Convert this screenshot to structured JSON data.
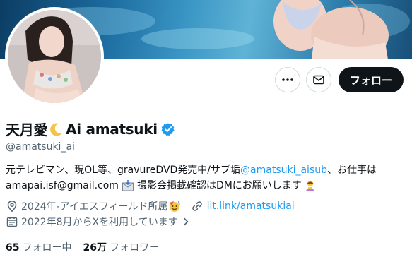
{
  "profile": {
    "display_name": "天月愛",
    "display_name_latin": "Ai amatsuki",
    "handle": "@amatsuki_ai",
    "verified": true
  },
  "actions": {
    "follow_label": "フォロー",
    "more_icon": "more-dots-icon",
    "message_icon": "envelope-icon"
  },
  "bio": {
    "line1_prefix": "元テレビマン、現OL等、gravureDVD発売中/サブ垢",
    "line1_link": "@amatsuki_aisub",
    "line1_suffix": "、お仕事は",
    "line2_email": "amapai.isf@gmail.com",
    "line2_text": "撮影会掲載確認はDMにお願いします"
  },
  "meta": {
    "location": "2024年-アイエスフィールド所属",
    "website": "lit.link/amatsukiai",
    "joined": "2022年8月からXを利用しています"
  },
  "stats": {
    "following_count": "65",
    "following_label": "フォロー中",
    "followers_count": "26万",
    "followers_label": "フォロワー"
  },
  "colors": {
    "accent": "#1d9bf0",
    "text": "#0f1419",
    "muted": "#536471",
    "button": "#0f1419"
  }
}
